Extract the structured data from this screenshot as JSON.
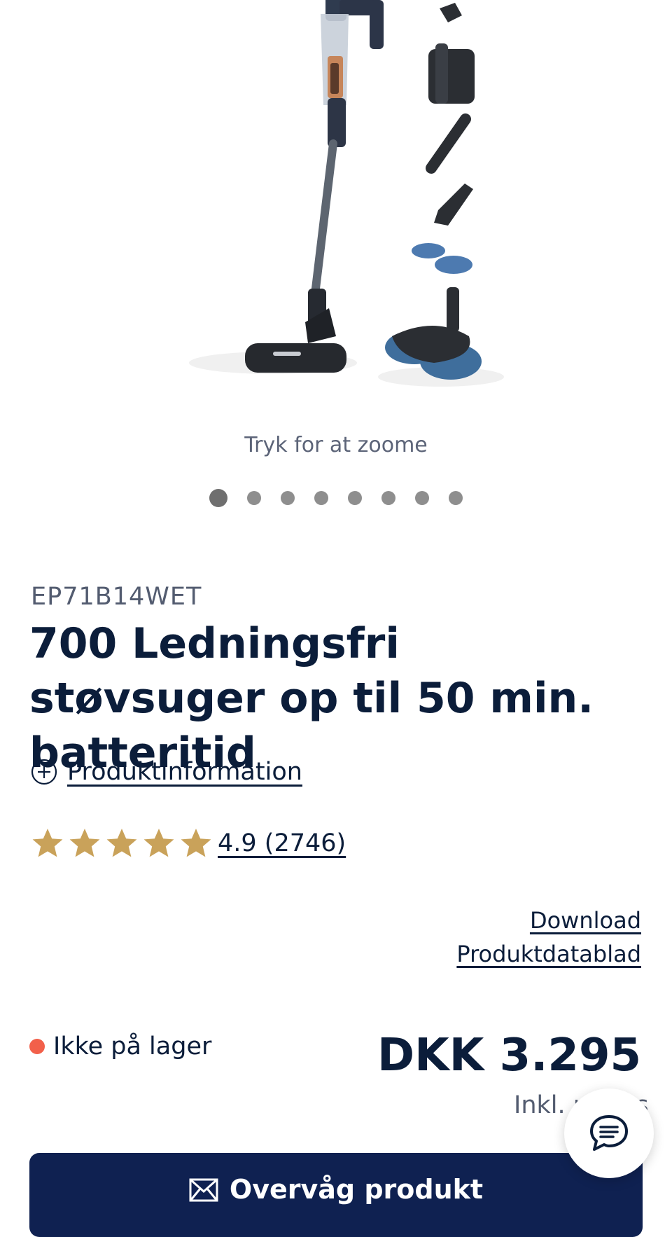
{
  "gallery": {
    "zoom_hint": "Tryk for at zoome",
    "dot_count": 8,
    "active_index": 0
  },
  "product": {
    "sku": "EP71B14WET",
    "title": "700 Ledningsfri støvsuger op til 50 min. batteritid",
    "info_link": "Produktinformation",
    "rating_value": 4.9,
    "rating_text": "4.9 (2746)",
    "download_line1": "Download",
    "download_line2": "Produktdatablad"
  },
  "availability": {
    "status": "Ikke på lager",
    "status_color": "#f2604a"
  },
  "pricing": {
    "price": "DKK 3.295",
    "vat": "Inkl. moms"
  },
  "cta": {
    "label": "Overvåg produkt",
    "background": "#0f2151"
  },
  "icons": {
    "info": "plus-circle-icon",
    "star": "star-icon",
    "cta": "envelope-icon",
    "chat": "chat-bubble-icon"
  },
  "colors": {
    "text": "#0b1d3a",
    "star": "#c9a25a",
    "muted": "#535c70"
  }
}
